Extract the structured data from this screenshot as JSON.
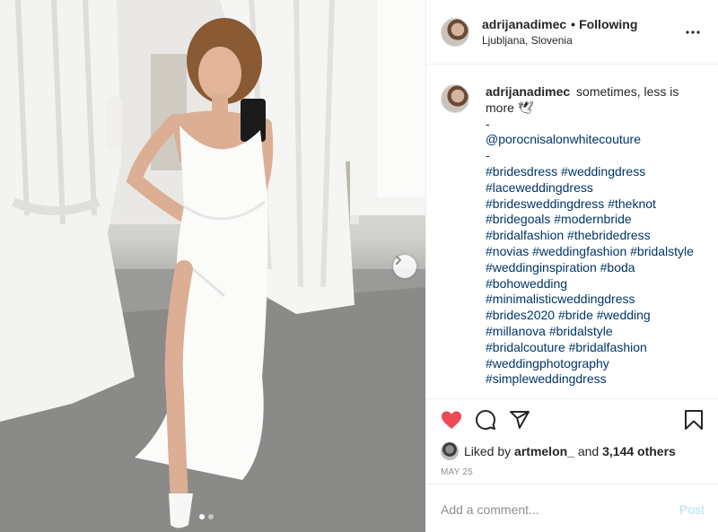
{
  "post": {
    "header": {
      "username": "adrijanadimec",
      "separator": "•",
      "follow_state": "Following",
      "location": "Ljubljana, Slovenia",
      "more_icon": "more-horizontal-icon"
    },
    "caption": {
      "username": "adrijanadimec",
      "text": "sometimes, less is more 🕊",
      "lines": [
        "-",
        "@porocnisalonwhitecouture",
        "-",
        "#bridesdress #weddingdress",
        "#laceweddingdress",
        "#bridesweddingdress #theknot",
        "#bridegoals #modernbride",
        "#bridalfashion #thebridedress",
        "#novias #weddingfashion #bridalstyle",
        "#weddinginspiration #boda",
        "#bohowedding",
        "#minimalisticweddingdress",
        "#brides2020 #bride #wedding",
        "#millanova #bridalstyle",
        "#bridalcouture #bridalfashion",
        "#weddingphotography",
        "#simpleweddingdress"
      ]
    },
    "actions": {
      "like_icon": "heart-filled-icon",
      "comment_icon": "comment-icon",
      "share_icon": "share-icon",
      "save_icon": "bookmark-icon",
      "like_color": "#ed4956"
    },
    "likes": {
      "prefix": "Liked by",
      "first_liker": "artmelon_",
      "connector": "and",
      "others": "3,144 others"
    },
    "date": "MAY 25",
    "comment": {
      "placeholder": "Add a comment...",
      "post_label": "Post"
    },
    "carousel": {
      "next_icon": "chevron-right-icon",
      "total_slides": 2,
      "active_slide": 1
    }
  }
}
